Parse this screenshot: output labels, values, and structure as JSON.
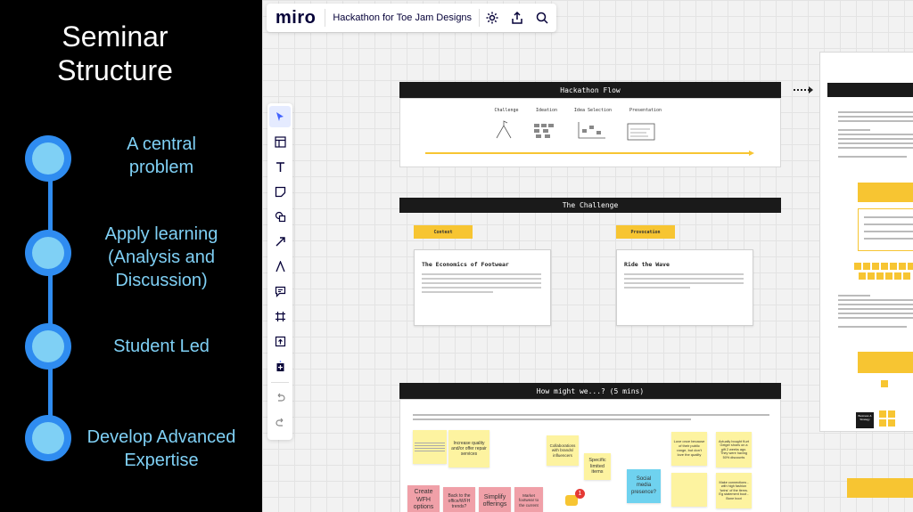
{
  "slide": {
    "title_line1": "Seminar",
    "title_line2": "Structure",
    "timeline": [
      {
        "label_line1": "A central",
        "label_line2": "problem",
        "label_line3": ""
      },
      {
        "label_line1": "Apply learning",
        "label_line2": "(Analysis and",
        "label_line3": "Discussion)"
      },
      {
        "label_line1": "Student Led",
        "label_line2": "",
        "label_line3": ""
      },
      {
        "label_line1": "Develop Advanced",
        "label_line2": "Expertise",
        "label_line3": ""
      }
    ],
    "accent": "#2f8cf0",
    "accent_light": "#7fd0f5"
  },
  "miro": {
    "logo": "miro",
    "board_name": "Hackathon for Toe Jam Designs",
    "topbar_icons": [
      "settings-icon",
      "share-icon",
      "search-icon"
    ],
    "toolbar_tools": [
      "select-icon",
      "templates-icon",
      "text-icon",
      "sticky-note-icon",
      "shapes-icon",
      "arrow-icon",
      "pen-icon",
      "comment-icon",
      "frame-icon",
      "upload-icon",
      "more-icon"
    ],
    "undo_icon": "undo-icon",
    "redo_icon": "redo-icon",
    "notification_count": "1"
  },
  "frames": {
    "hackathon_flow": {
      "title": "Hackathon Flow",
      "steps": [
        "Challenge",
        "Ideation",
        "Idea Selection",
        "Presentation"
      ]
    },
    "challenge": {
      "title": "The Challenge",
      "tag_context": "Context",
      "tag_provocation": "Provocation",
      "card1_title": "The Economics of Footwear",
      "card2_title": "Ride the Wave"
    },
    "how_might_we": {
      "title": "How might we...? (5 mins)",
      "stickies": {
        "increase": "Increase quality and/or offer repair services",
        "collaborate": "Collaborations with brands/ influencers",
        "specific": "Specific limited items",
        "social": "Social media presence?",
        "love": "Love once because of their public range, but don't love the quality",
        "actually": "Actually bought Kurt Geiger shoes on a gift 2 weeks ago. They were having 50% discounts",
        "make": "Make connections - with high fashion 'twins' of the items. Eg statement boot - Bone boot",
        "create": "Create WFH options",
        "back": "Back to the office/WFH trends?",
        "simplify": "Simplify offerings",
        "market": "Market footwear to the current"
      }
    }
  },
  "right_frame": {
    "business_label": "Business & Strategy"
  },
  "colors": {
    "sticky_yellow": "#fdf3a0",
    "sticky_pink": "#f0a0a8",
    "sticky_blue": "#6fd2ef",
    "tag_yellow": "#f7c532",
    "frame_header": "#1a1a1a"
  }
}
